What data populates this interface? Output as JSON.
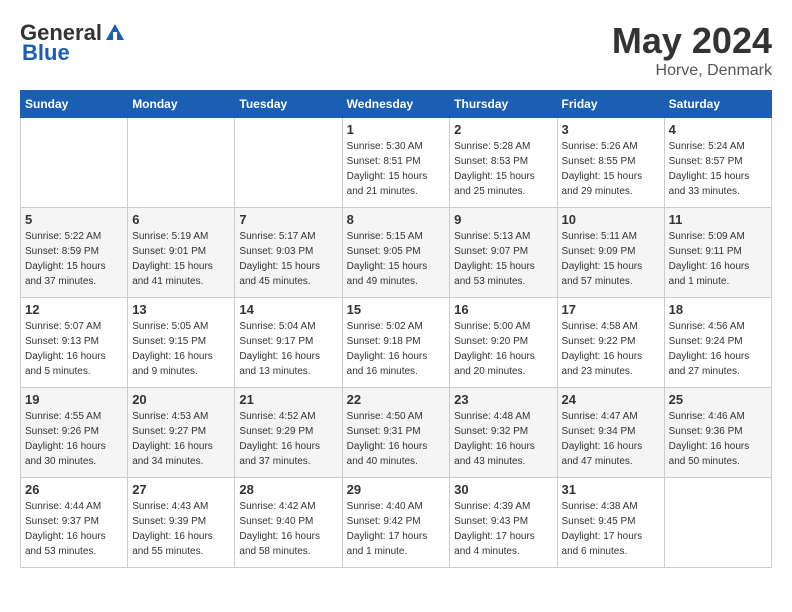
{
  "header": {
    "logo_general": "General",
    "logo_blue": "Blue",
    "month": "May 2024",
    "location": "Horve, Denmark"
  },
  "days_of_week": [
    "Sunday",
    "Monday",
    "Tuesday",
    "Wednesday",
    "Thursday",
    "Friday",
    "Saturday"
  ],
  "weeks": [
    {
      "cells": [
        {
          "day": "",
          "info": ""
        },
        {
          "day": "",
          "info": ""
        },
        {
          "day": "",
          "info": ""
        },
        {
          "day": "1",
          "info": "Sunrise: 5:30 AM\nSunset: 8:51 PM\nDaylight: 15 hours\nand 21 minutes."
        },
        {
          "day": "2",
          "info": "Sunrise: 5:28 AM\nSunset: 8:53 PM\nDaylight: 15 hours\nand 25 minutes."
        },
        {
          "day": "3",
          "info": "Sunrise: 5:26 AM\nSunset: 8:55 PM\nDaylight: 15 hours\nand 29 minutes."
        },
        {
          "day": "4",
          "info": "Sunrise: 5:24 AM\nSunset: 8:57 PM\nDaylight: 15 hours\nand 33 minutes."
        }
      ]
    },
    {
      "cells": [
        {
          "day": "5",
          "info": "Sunrise: 5:22 AM\nSunset: 8:59 PM\nDaylight: 15 hours\nand 37 minutes."
        },
        {
          "day": "6",
          "info": "Sunrise: 5:19 AM\nSunset: 9:01 PM\nDaylight: 15 hours\nand 41 minutes."
        },
        {
          "day": "7",
          "info": "Sunrise: 5:17 AM\nSunset: 9:03 PM\nDaylight: 15 hours\nand 45 minutes."
        },
        {
          "day": "8",
          "info": "Sunrise: 5:15 AM\nSunset: 9:05 PM\nDaylight: 15 hours\nand 49 minutes."
        },
        {
          "day": "9",
          "info": "Sunrise: 5:13 AM\nSunset: 9:07 PM\nDaylight: 15 hours\nand 53 minutes."
        },
        {
          "day": "10",
          "info": "Sunrise: 5:11 AM\nSunset: 9:09 PM\nDaylight: 15 hours\nand 57 minutes."
        },
        {
          "day": "11",
          "info": "Sunrise: 5:09 AM\nSunset: 9:11 PM\nDaylight: 16 hours\nand 1 minute."
        }
      ]
    },
    {
      "cells": [
        {
          "day": "12",
          "info": "Sunrise: 5:07 AM\nSunset: 9:13 PM\nDaylight: 16 hours\nand 5 minutes."
        },
        {
          "day": "13",
          "info": "Sunrise: 5:05 AM\nSunset: 9:15 PM\nDaylight: 16 hours\nand 9 minutes."
        },
        {
          "day": "14",
          "info": "Sunrise: 5:04 AM\nSunset: 9:17 PM\nDaylight: 16 hours\nand 13 minutes."
        },
        {
          "day": "15",
          "info": "Sunrise: 5:02 AM\nSunset: 9:18 PM\nDaylight: 16 hours\nand 16 minutes."
        },
        {
          "day": "16",
          "info": "Sunrise: 5:00 AM\nSunset: 9:20 PM\nDaylight: 16 hours\nand 20 minutes."
        },
        {
          "day": "17",
          "info": "Sunrise: 4:58 AM\nSunset: 9:22 PM\nDaylight: 16 hours\nand 23 minutes."
        },
        {
          "day": "18",
          "info": "Sunrise: 4:56 AM\nSunset: 9:24 PM\nDaylight: 16 hours\nand 27 minutes."
        }
      ]
    },
    {
      "cells": [
        {
          "day": "19",
          "info": "Sunrise: 4:55 AM\nSunset: 9:26 PM\nDaylight: 16 hours\nand 30 minutes."
        },
        {
          "day": "20",
          "info": "Sunrise: 4:53 AM\nSunset: 9:27 PM\nDaylight: 16 hours\nand 34 minutes."
        },
        {
          "day": "21",
          "info": "Sunrise: 4:52 AM\nSunset: 9:29 PM\nDaylight: 16 hours\nand 37 minutes."
        },
        {
          "day": "22",
          "info": "Sunrise: 4:50 AM\nSunset: 9:31 PM\nDaylight: 16 hours\nand 40 minutes."
        },
        {
          "day": "23",
          "info": "Sunrise: 4:48 AM\nSunset: 9:32 PM\nDaylight: 16 hours\nand 43 minutes."
        },
        {
          "day": "24",
          "info": "Sunrise: 4:47 AM\nSunset: 9:34 PM\nDaylight: 16 hours\nand 47 minutes."
        },
        {
          "day": "25",
          "info": "Sunrise: 4:46 AM\nSunset: 9:36 PM\nDaylight: 16 hours\nand 50 minutes."
        }
      ]
    },
    {
      "cells": [
        {
          "day": "26",
          "info": "Sunrise: 4:44 AM\nSunset: 9:37 PM\nDaylight: 16 hours\nand 53 minutes."
        },
        {
          "day": "27",
          "info": "Sunrise: 4:43 AM\nSunset: 9:39 PM\nDaylight: 16 hours\nand 55 minutes."
        },
        {
          "day": "28",
          "info": "Sunrise: 4:42 AM\nSunset: 9:40 PM\nDaylight: 16 hours\nand 58 minutes."
        },
        {
          "day": "29",
          "info": "Sunrise: 4:40 AM\nSunset: 9:42 PM\nDaylight: 17 hours\nand 1 minute."
        },
        {
          "day": "30",
          "info": "Sunrise: 4:39 AM\nSunset: 9:43 PM\nDaylight: 17 hours\nand 4 minutes."
        },
        {
          "day": "31",
          "info": "Sunrise: 4:38 AM\nSunset: 9:45 PM\nDaylight: 17 hours\nand 6 minutes."
        },
        {
          "day": "",
          "info": ""
        }
      ]
    }
  ]
}
